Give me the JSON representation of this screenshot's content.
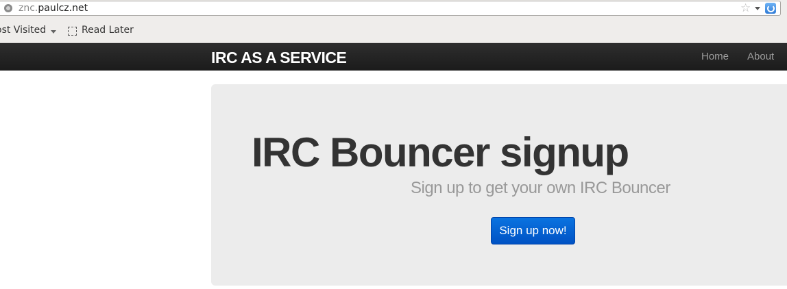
{
  "browser": {
    "url_prefix": "znc.",
    "url_domain": "paulcz.net",
    "bookmarks": [
      {
        "label": "ost Visited"
      },
      {
        "label": "Read Later"
      }
    ]
  },
  "navbar": {
    "brand": "IRC AS A SERVICE",
    "links": [
      {
        "label": "Home"
      },
      {
        "label": "About"
      }
    ]
  },
  "hero": {
    "title": "IRC Bouncer signup",
    "subtitle": "Sign up to get your own IRC Bouncer",
    "cta_label": "Sign up now!"
  },
  "colors": {
    "navbar": "#1b1b1b",
    "hero_bg": "#ececec",
    "cta": "#0a6ad6"
  }
}
